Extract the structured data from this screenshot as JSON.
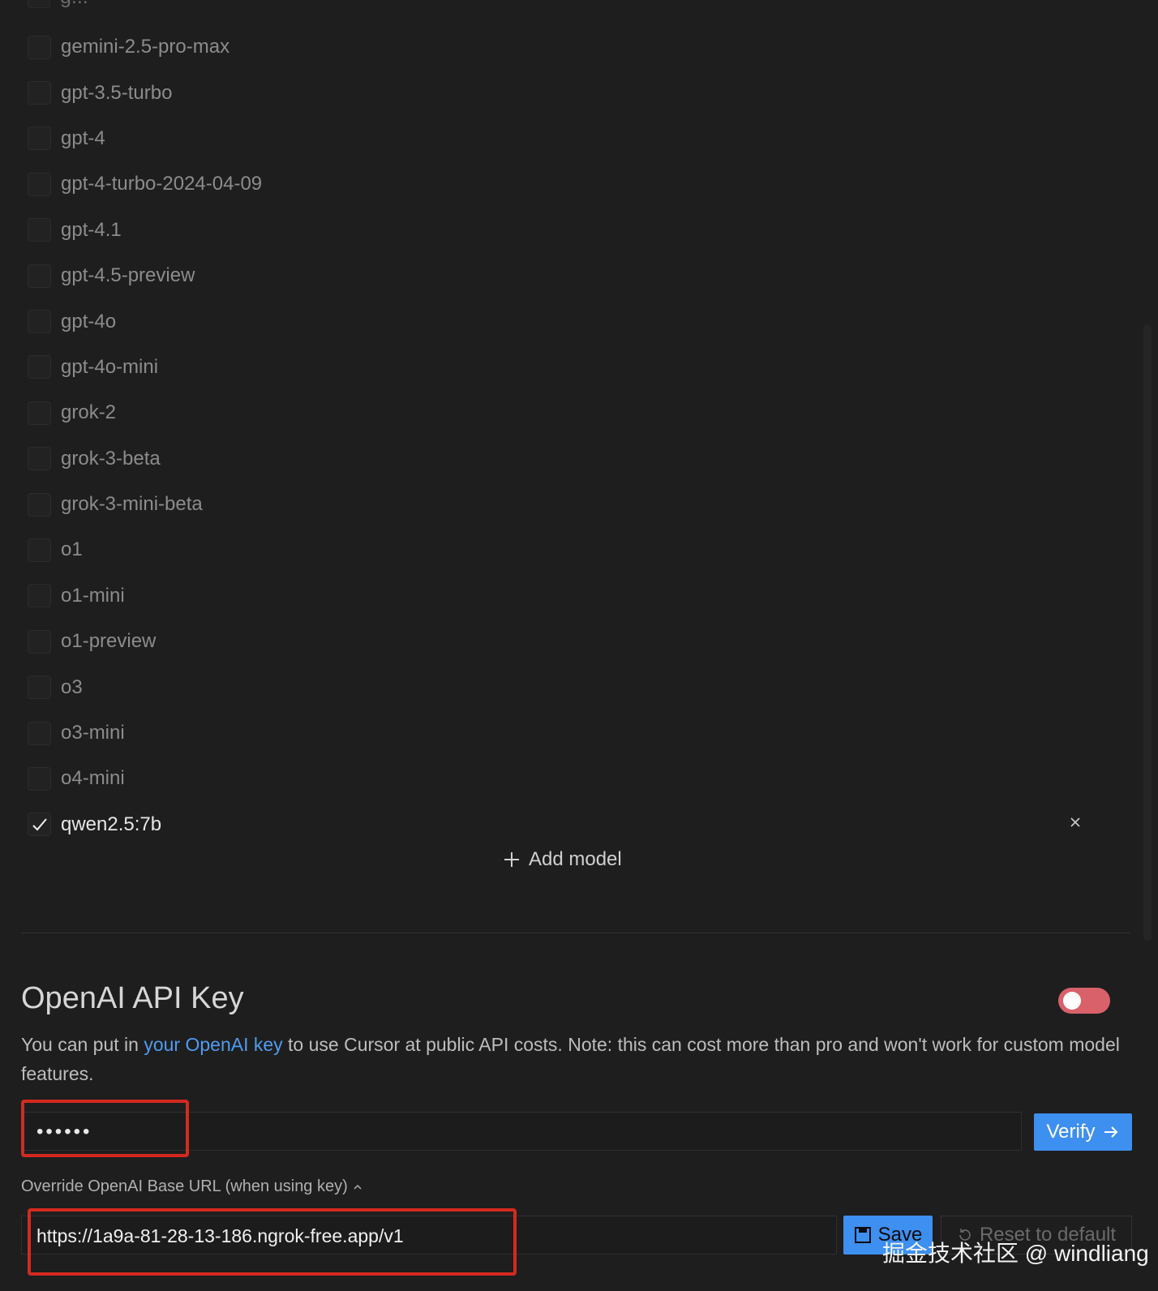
{
  "models": [
    {
      "label": "gemini-2.5-pro-max",
      "checked": false
    },
    {
      "label": "gpt-3.5-turbo",
      "checked": false
    },
    {
      "label": "gpt-4",
      "checked": false
    },
    {
      "label": "gpt-4-turbo-2024-04-09",
      "checked": false
    },
    {
      "label": "gpt-4.1",
      "checked": false
    },
    {
      "label": "gpt-4.5-preview",
      "checked": false
    },
    {
      "label": "gpt-4o",
      "checked": false
    },
    {
      "label": "gpt-4o-mini",
      "checked": false
    },
    {
      "label": "grok-2",
      "checked": false
    },
    {
      "label": "grok-3-beta",
      "checked": false
    },
    {
      "label": "grok-3-mini-beta",
      "checked": false
    },
    {
      "label": "o1",
      "checked": false
    },
    {
      "label": "o1-mini",
      "checked": false
    },
    {
      "label": "o1-preview",
      "checked": false
    },
    {
      "label": "o3",
      "checked": false
    },
    {
      "label": "o3-mini",
      "checked": false
    },
    {
      "label": "o4-mini",
      "checked": false
    },
    {
      "label": "qwen2.5:7b",
      "checked": true,
      "removable": true
    }
  ],
  "add_model_label": "Add model",
  "openai": {
    "title": "OpenAI API Key",
    "toggle_on": false,
    "toggle_color": "#d8616a",
    "desc_before": "You can put in ",
    "desc_link": "your OpenAI key",
    "desc_after": " to use Cursor at public API costs. Note: this can cost more than pro and won't work for custom model features.",
    "key_value": "••••••",
    "verify_label": "Verify",
    "override_label": "Override OpenAI Base URL (when using key)",
    "base_url": "https://1a9a-81-28-13-186.ngrok-free.app/v1",
    "save_label": "Save",
    "reset_label": "Reset to default"
  },
  "accent_color": "#3d8ff0",
  "highlight_color": "#d32a20",
  "watermark": "掘金技术社区 @ windliang"
}
